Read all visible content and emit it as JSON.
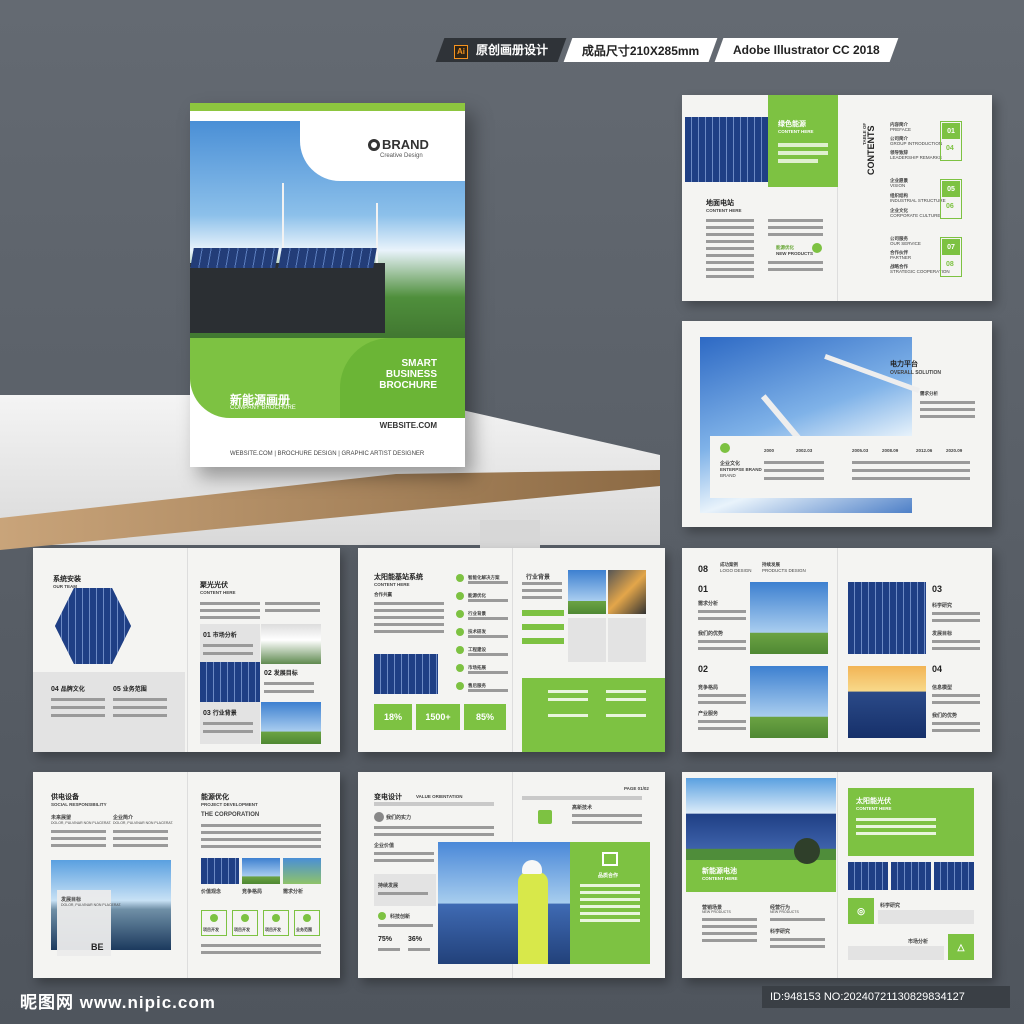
{
  "header": {
    "format_label": "原创画册设计",
    "size_label": "成品尺寸210X285mm",
    "software_label": "Adobe Illustrator CC 2018",
    "ai_icon": "Ai"
  },
  "cover": {
    "brand": "BRAND",
    "brand_sub": "Creative Design",
    "title_lines": [
      "SMART",
      "BUSINESS",
      "BROCHURE"
    ],
    "cn_title": "新能源画册",
    "cn_sub": "COMPANY BROCHURE",
    "website": "WEBSITE.COM",
    "footer": "WEBSITE.COM  |  BROCHURE DESIGN  |  GRAPHIC ARTIST DESIGNER"
  },
  "spread1": {
    "green_title": "绿色能源",
    "green_sub": "CONTENT HERE",
    "left_title": "地面电站",
    "left_sub": "CONTENT HERE",
    "new_products": "能源优化",
    "new_products_sub": "NEW PRODUCTS",
    "toc_title": "CONTENTS",
    "toc_small": "TABLE OF",
    "toc_items": [
      {
        "cn": "内容简介",
        "en": "PREFACE"
      },
      {
        "cn": "公司简介",
        "en": "GROUP INTRODUCTION"
      },
      {
        "cn": "领导致辞",
        "en": "LEADERSHIP REMARKS"
      },
      {
        "cn": "企业愿景",
        "en": "VISION"
      },
      {
        "cn": "组织结构",
        "en": "INDUSTRIAL STRUCTURE"
      },
      {
        "cn": "企业文化",
        "en": "CORPORATE CULTURE"
      },
      {
        "cn": "公司服务",
        "en": "OUR SERVICE"
      },
      {
        "cn": "合作伙伴",
        "en": "PARTNER"
      },
      {
        "cn": "战略合作",
        "en": "STRATEGIC COOPERATION"
      }
    ],
    "toc_numbers": [
      "01",
      "04",
      "05",
      "06",
      "07",
      "08"
    ]
  },
  "spread2": {
    "title": "电力平台",
    "sub": "OVERALL SOLUTION",
    "need": "需求分析",
    "brand_title": "企业文化",
    "brand_sub": "ENTERPSE BRAND",
    "years": [
      "2000",
      "2002.03",
      "2005.03",
      "2008.09",
      "2012.06",
      "2020.09"
    ]
  },
  "spread3": {
    "title1": "系统安装",
    "sub1": "OUR TEAM",
    "title2": "聚光光伏",
    "sub2": "CONTENT HERE",
    "items": [
      {
        "n": "01",
        "t": "市场分析"
      },
      {
        "n": "02",
        "t": "发展目标"
      },
      {
        "n": "03",
        "t": "行业背景"
      },
      {
        "n": "04",
        "t": "品牌文化"
      },
      {
        "n": "05",
        "t": "业务范围"
      }
    ]
  },
  "spread4": {
    "title": "太阳能基站系统",
    "sub": "CONTENT HERE",
    "partner": "合作共赢",
    "industry": "行业背景",
    "stats": [
      "18%",
      "1500+",
      "85%"
    ],
    "list": [
      "智能化解决方案",
      "能源优化",
      "行业背景",
      "技术研发",
      "工程建设",
      "市场拓展",
      "售后服务"
    ]
  },
  "spread5": {
    "header_num": "08",
    "header_cn": "成功案例",
    "header_en": "LOGO DESIGN",
    "header2_cn": "持续发展",
    "header2_en": "PRODUCTS DESIGN",
    "items": [
      {
        "n": "01",
        "a": "需求分析",
        "b": "我们的优势"
      },
      {
        "n": "02",
        "a": "竞争格局",
        "b": "产业服务"
      },
      {
        "n": "03",
        "a": "科学研究",
        "b": "发展目标"
      },
      {
        "n": "04",
        "a": "信息模型",
        "b": "我们的优势"
      }
    ]
  },
  "spread6": {
    "title1": "供电设备",
    "sub1": "SOCIAL RESPONSIBILITY",
    "col1": "未来展望",
    "col1_sub": "DOLOR, PULVINAR NON PLACERAT.",
    "col2": "企业简介",
    "col2_sub": "DOLOR, PULVINAR NON PLACERAT.",
    "goal": "发展目标",
    "goal_sub": "DOLOR, PULVINAR NON PLACERAT.",
    "be": "BE",
    "title2": "能源优化",
    "sub2": "PROJECT DEVELOPMENT",
    "corp": "THE CORPORATION",
    "captions": [
      "价值观念",
      "竞争格局",
      "需求分析"
    ],
    "icons": [
      "项目开发",
      "项目开发",
      "项目开发",
      "业务范围"
    ]
  },
  "spread7": {
    "title": "变电设计",
    "sub": "VALUE ORIENTATION",
    "page": "PAGE 01/02",
    "items": [
      "我们的实力",
      "企业价值",
      "持续发展",
      "科技创新"
    ],
    "stats": [
      "75%",
      "36%"
    ],
    "high_tech": "高新技术",
    "coop": "品质合作"
  },
  "spread8": {
    "title": "太阳能光伏",
    "sub": "CONTENT HERE",
    "left_title": "新能源电池",
    "left_sub": "CONTENT HERE",
    "items": [
      {
        "cn": "营销场景",
        "en": "NEW PRODUCTS"
      },
      {
        "cn": "经营行为",
        "en": "NEW PRODUCTS"
      },
      {
        "cn": "科学研究",
        "en": ""
      }
    ],
    "sci": "科学研究",
    "market": "市场分析"
  },
  "footer": {
    "watermark": "昵图网 www.nipic.com",
    "id": "ID:948153 NO:20240721130829834127"
  }
}
